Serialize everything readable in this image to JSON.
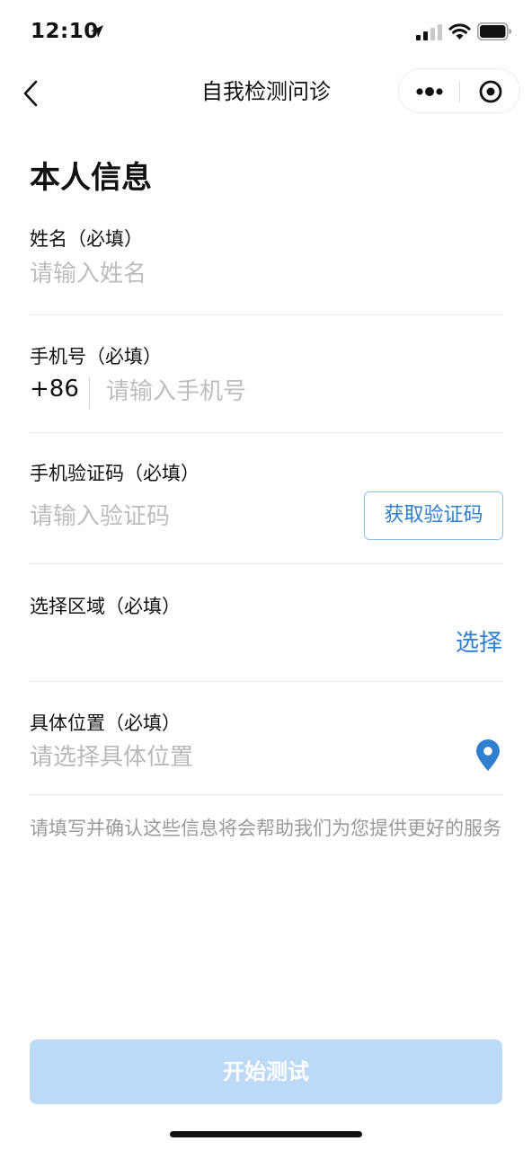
{
  "status_bar": {
    "time": "12:10",
    "icons": [
      "location-arrow-icon",
      "cellular-signal-icon",
      "wifi-icon",
      "battery-icon"
    ]
  },
  "nav": {
    "title": "自我检测问诊",
    "back_icon": "chevron-left-icon",
    "capsule_icons": [
      "more-dots-icon",
      "close-target-icon"
    ]
  },
  "form": {
    "section_title": "本人信息",
    "name": {
      "label": "姓名（必填）",
      "placeholder": "请输入姓名",
      "value": ""
    },
    "phone": {
      "label": "手机号（必填）",
      "prefix": "+86",
      "placeholder": "请输入手机号",
      "value": ""
    },
    "code": {
      "label": "手机验证码（必填）",
      "placeholder": "请输入验证码",
      "value": "",
      "button": "获取验证码"
    },
    "region": {
      "label": "选择区域（必填）",
      "action": "选择"
    },
    "location": {
      "label": "具体位置（必填）",
      "placeholder": "请选择具体位置",
      "icon": "location-pin-icon"
    },
    "note": "请填写并确认这些信息将会帮助我们为您提供更好的服务"
  },
  "footer": {
    "start_button": "开始测试"
  },
  "colors": {
    "accent": "#2f7fce",
    "button_disabled": "#bcd9f7",
    "placeholder": "#b9b9b9",
    "divider": "#eaeaea"
  }
}
